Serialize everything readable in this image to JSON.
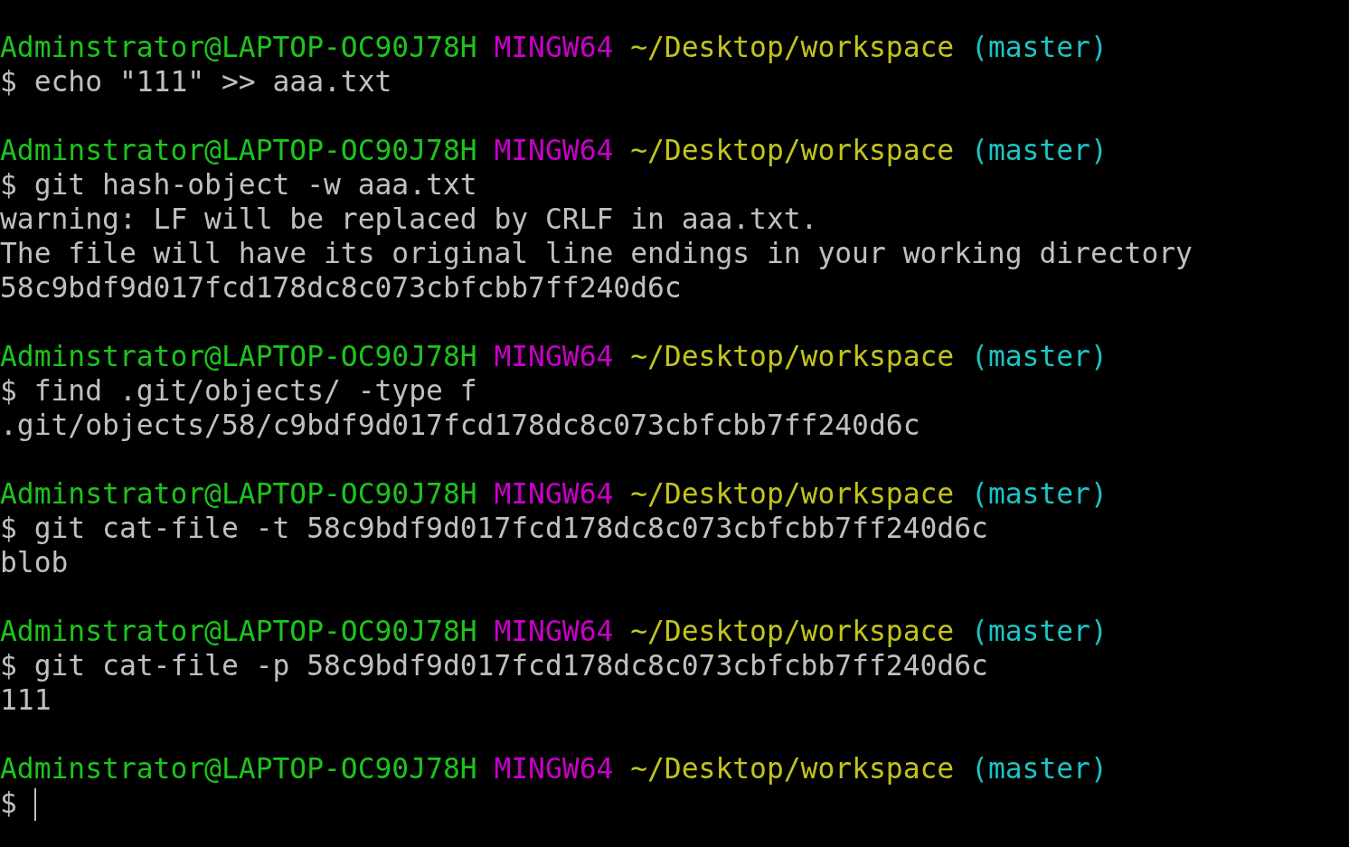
{
  "terminal": {
    "blocks": [
      {
        "prompt": {
          "user_host": "Adminstrator@LAPTOP-OC90J78H",
          "system": "MINGW64",
          "path": "~/Desktop/workspace",
          "branch": "(master)"
        },
        "input": "$ echo \"111\" >> aaa.txt",
        "cursor": false
      },
      {
        "prompt": {
          "user_host": "Adminstrator@LAPTOP-OC90J78H",
          "system": "MINGW64",
          "path": "~/Desktop/workspace",
          "branch": "(master)"
        },
        "input": "$ git hash-object -w aaa.txt",
        "output": [
          "warning: LF will be replaced by CRLF in aaa.txt.",
          "The file will have its original line endings in your working directory",
          "58c9bdf9d017fcd178dc8c073cbfcbb7ff240d6c"
        ],
        "cursor": false
      },
      {
        "prompt": {
          "user_host": "Adminstrator@LAPTOP-OC90J78H",
          "system": "MINGW64",
          "path": "~/Desktop/workspace",
          "branch": "(master)"
        },
        "input": "$ find .git/objects/ -type f",
        "output": [
          ".git/objects/58/c9bdf9d017fcd178dc8c073cbfcbb7ff240d6c"
        ],
        "cursor": false
      },
      {
        "prompt": {
          "user_host": "Adminstrator@LAPTOP-OC90J78H",
          "system": "MINGW64",
          "path": "~/Desktop/workspace",
          "branch": "(master)"
        },
        "input": "$ git cat-file -t 58c9bdf9d017fcd178dc8c073cbfcbb7ff240d6c",
        "output": [
          "blob"
        ],
        "cursor": false
      },
      {
        "prompt": {
          "user_host": "Adminstrator@LAPTOP-OC90J78H",
          "system": "MINGW64",
          "path": "~/Desktop/workspace",
          "branch": "(master)"
        },
        "input": "$ git cat-file -p 58c9bdf9d017fcd178dc8c073cbfcbb7ff240d6c",
        "output": [
          "111"
        ],
        "cursor": false
      },
      {
        "prompt": {
          "user_host": "Adminstrator@LAPTOP-OC90J78H",
          "system": "MINGW64",
          "path": "~/Desktop/workspace",
          "branch": "(master)"
        },
        "input": "$",
        "cursor": true
      }
    ]
  }
}
